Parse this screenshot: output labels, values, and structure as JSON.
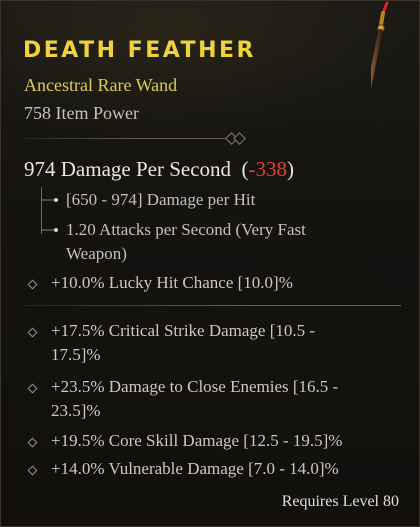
{
  "item": {
    "name": "Death Feather",
    "type": "Ancestral Rare Wand",
    "item_power": "758 Item Power",
    "dps_text": "974 Damage Per Second",
    "dps_delta": "-338",
    "weapon_stats": [
      "[650 - 974] Damage per Hit",
      "1.20 Attacks per Second (Very Fast",
      "Weapon)"
    ],
    "implicit": "+10.0% Lucky Hit Chance [10.0]%",
    "affixes": [
      {
        "line1": "+17.5% Critical Strike Damage [10.5 -",
        "line2": "17.5]%"
      },
      {
        "line1": "+23.5% Damage to Close Enemies [16.5 -",
        "line2": "23.5]%"
      },
      {
        "line1": "+19.5% Core Skill Damage [12.5 - 19.5]%",
        "line2": ""
      },
      {
        "line1": "+14.0% Vulnerable Damage [7.0 - 14.0]%",
        "line2": ""
      }
    ],
    "requirement": "Requires Level 80"
  },
  "colors": {
    "rare_name": "#f2d23a",
    "rare_type": "#dccd55",
    "negative_delta": "#e5402e"
  },
  "icons": {
    "item": "wand-icon",
    "divider": "diamond-divider-icon",
    "affix_bullet": "diamond-bullet-icon",
    "sub_bullet": "branch-arrow-icon"
  }
}
